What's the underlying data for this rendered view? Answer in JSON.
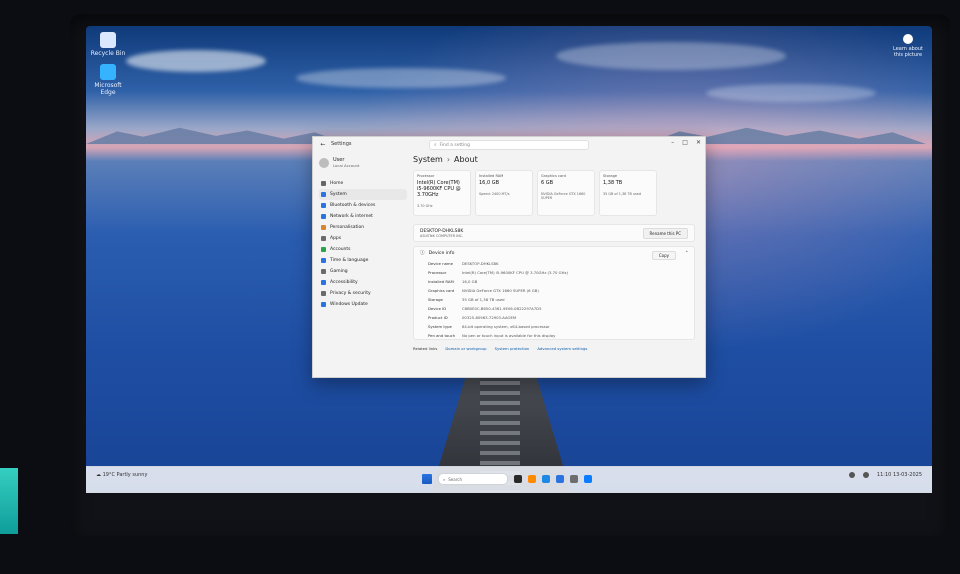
{
  "desktop": {
    "icons": [
      {
        "label": "Recycle Bin",
        "color": "#dbe7ff"
      },
      {
        "label": "Microsoft Edge",
        "color": "#35b3ff"
      }
    ],
    "watermark": "Learn about this picture"
  },
  "settings": {
    "app_title": "Settings",
    "search_placeholder": "Find a setting",
    "page_title_section": "System",
    "page_title_page": "About",
    "user": {
      "name": "User",
      "subtitle": "Local Account"
    },
    "nav": [
      {
        "label": "Home",
        "icon": "home-icon",
        "color": "#666"
      },
      {
        "label": "System",
        "icon": "system-icon",
        "color": "#2b74e0",
        "active": true
      },
      {
        "label": "Bluetooth & devices",
        "icon": "bluetooth-icon",
        "color": "#2b74e0"
      },
      {
        "label": "Network & internet",
        "icon": "network-icon",
        "color": "#2b74e0"
      },
      {
        "label": "Personalisation",
        "icon": "brush-icon",
        "color": "#d9852b"
      },
      {
        "label": "Apps",
        "icon": "apps-icon",
        "color": "#6b6b6b"
      },
      {
        "label": "Accounts",
        "icon": "account-icon",
        "color": "#2ba34a"
      },
      {
        "label": "Time & language",
        "icon": "globe-icon",
        "color": "#2b74e0"
      },
      {
        "label": "Gaming",
        "icon": "gaming-icon",
        "color": "#6b6b6b"
      },
      {
        "label": "Accessibility",
        "icon": "accessibility-icon",
        "color": "#2b74e0"
      },
      {
        "label": "Privacy & security",
        "icon": "shield-icon",
        "color": "#6b6b6b"
      },
      {
        "label": "Windows Update",
        "icon": "update-icon",
        "color": "#2b74e0"
      }
    ],
    "cards": [
      {
        "label": "Processor",
        "value": "Intel(R) Core(TM) i5-9600KF CPU @ 3.70GHz",
        "sub": "3.70 GHz"
      },
      {
        "label": "Installed RAM",
        "value": "16,0 GB",
        "sub": "Speed: 2400 MT/s"
      },
      {
        "label": "Graphics card",
        "value": "6 GB",
        "sub": "NVIDIA GeForce GTX 1660 SUPER"
      },
      {
        "label": "Storage",
        "value": "1,38 TB",
        "sub": "35 GB of 1,38 TB used"
      }
    ],
    "device_bar": {
      "name": "DESKTOP-DHKLS8K",
      "sub": "ASUSTeK COMPUTER INC.",
      "rename": "Rename this PC"
    },
    "spec": {
      "title": "Device info",
      "copy": "Copy",
      "rows": [
        {
          "k": "Device name",
          "v": "DESKTOP-DHKLS8K"
        },
        {
          "k": "Processor",
          "v": "Intel(R) Core(TM) i5-9600KF CPU @ 3.70GHz (3.70 GHz)"
        },
        {
          "k": "Installed RAM",
          "v": "16,0 GB"
        },
        {
          "k": "Graphics card",
          "v": "NVIDIA GeForce GTX 1660 SUPER (6 GB)"
        },
        {
          "k": "Storage",
          "v": "35 GB of 1,38 TB used"
        },
        {
          "k": "Device ID",
          "v": "C8B0E0C-B650-4361-9E06-0B22297A7D5"
        },
        {
          "k": "Product ID",
          "v": "00325-80963-72903-AAOEM"
        },
        {
          "k": "System type",
          "v": "64-bit operating system, x64-based processor"
        },
        {
          "k": "Pen and touch",
          "v": "No pen or touch input is available for this display"
        }
      ]
    },
    "related": {
      "label": "Related links",
      "links": [
        "Domain or workgroup",
        "System protection",
        "Advanced system settings"
      ]
    }
  },
  "taskbar": {
    "weather": "19°C Partly sunny",
    "search_placeholder": "Search",
    "time": "11:10",
    "date": "13-03-2025",
    "apps": [
      "#2a2a2a",
      "#ff8a00",
      "#1e88e5",
      "#2b74e0",
      "#6d6d6d",
      "#0a7cff"
    ]
  }
}
